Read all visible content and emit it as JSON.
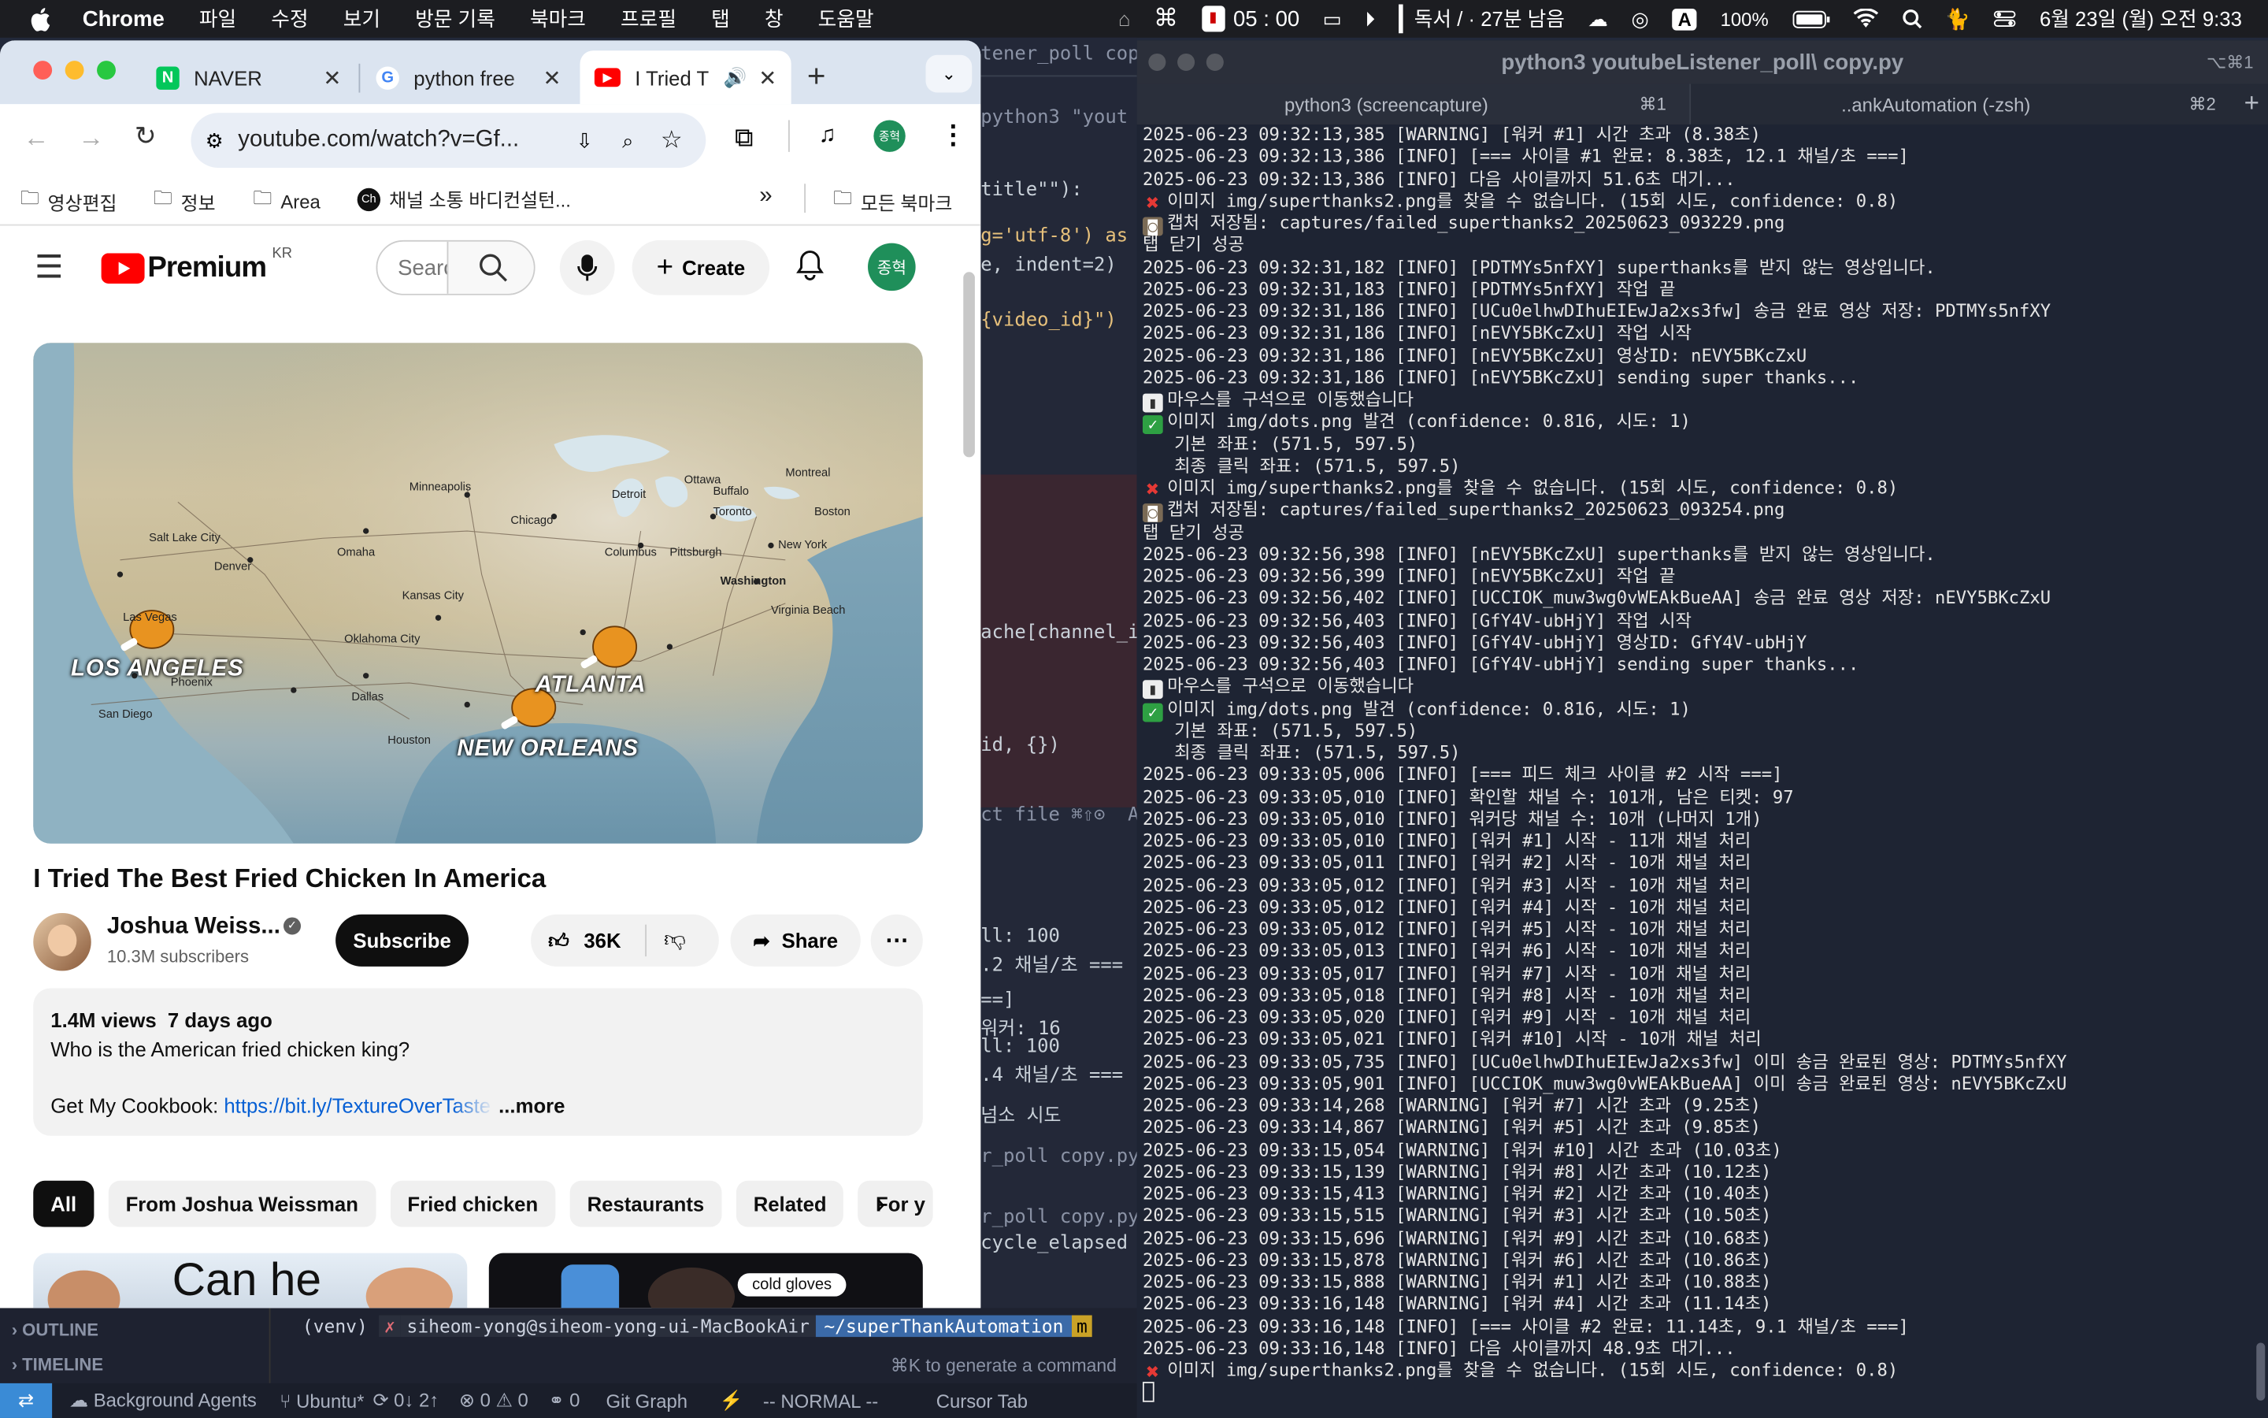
{
  "menubar": {
    "app": "Chrome",
    "items": [
      "파일",
      "수정",
      "보기",
      "방문 기록",
      "북마크",
      "프로필",
      "탭",
      "창",
      "도움말"
    ],
    "timer": "05 : 00",
    "reading": "독서 / · 27분 남음",
    "battery": "100%",
    "datetime": "6월 23일 (월) 오전 9:33",
    "input_source": "A"
  },
  "chrome": {
    "tabs": [
      {
        "title": "NAVER",
        "fav_color": "#03c75a",
        "fav_text": "N"
      },
      {
        "title": "python free",
        "fav_color": "#ffffff",
        "fav_text": "G"
      },
      {
        "title": "I Tried T",
        "fav_color": "#ff0000",
        "fav_text": "▶"
      }
    ],
    "url": "youtube.com/watch?v=Gf...",
    "profile": "종혁",
    "bookmarks": [
      "영상편집",
      "정보",
      "Area",
      "채널 소통 바디컨설턴...",
      "모든 북마크"
    ]
  },
  "youtube": {
    "logo_text": "Premium",
    "region": "KR",
    "search_placeholder": "Search",
    "create_label": "Create",
    "avatar": "종혁",
    "map_labels": {
      "la": "LOS ANGELES",
      "atlanta": "ATLANTA",
      "no": "NEW ORLEANS"
    },
    "map_cities": [
      "Ottawa",
      "Montreal",
      "Toronto",
      "Boston",
      "New York",
      "Washington",
      "Chicago",
      "Minneapolis",
      "Denver",
      "Kansas City",
      "Dallas",
      "Houston",
      "Phoenix",
      "San Diego",
      "Las Vegas",
      "Salt Lake City",
      "Pittsburgh",
      "Columbus",
      "Detroit",
      "Virginia Beach",
      "Buffalo",
      "Omaha",
      "Oklahoma City"
    ],
    "video_title": "I Tried The Best Fried Chicken In America",
    "channel": "Joshua Weiss...",
    "subscribers": "10.3M subscribers",
    "subscribe": "Subscribe",
    "likes": "36K",
    "share": "Share",
    "views_date": "1.4M views  7 days ago",
    "description_line1": "Who is the American fried chicken king?",
    "description_prefix": "Get My Cookbook:",
    "description_link": "https://bit.ly/TextureOverTaste",
    "more": "...more",
    "chips": [
      "All",
      "From Joshua Weissman",
      "Fried chicken",
      "Restaurants",
      "Related",
      "For y"
    ],
    "thumb1_text": "Can he",
    "thumb2_badge": "cold gloves"
  },
  "editor": {
    "lines": [
      {
        "t": "tener_poll copy.p",
        "c": "#8b93a6"
      },
      {
        "t": "python3 \"yout",
        "c": "#8b93a6"
      },
      {
        "t": "title\"\"):",
        "c": "#c9d1d9"
      },
      {
        "t": "g='utf-8') as",
        "c": "#e6c07b"
      },
      {
        "t": "e, indent=2)",
        "c": "#c9d1d9"
      },
      {
        "t": "{video_id}\")",
        "c": "#e6c07b"
      },
      {
        "t": "ache[channel_i",
        "c": "#c9d1d9"
      },
      {
        "t": "id, {})",
        "c": "#c9d1d9"
      },
      {
        "t": "ct file ⌘⇧⊙  Acce",
        "c": "#8b93a6"
      },
      {
        "t": "ll: 100",
        "c": "#c9d1d9"
      },
      {
        "t": ".2 채널/초 ===",
        "c": "#c9d1d9"
      },
      {
        "t": "==]",
        "c": "#c9d1d9"
      },
      {
        "t": "워커: 16",
        "c": "#c9d1d9"
      },
      {
        "t": "ll: 100",
        "c": "#c9d1d9"
      },
      {
        "t": ".4 채널/초 ===",
        "c": "#c9d1d9"
      },
      {
        "t": "넘소 시도",
        "c": "#c9d1d9"
      },
      {
        "t": "r_poll copy.py",
        "c": "#8b93a6"
      },
      {
        "t": "r_poll copy.py",
        "c": "#8b93a6"
      },
      {
        "t": "cycle_elapsed",
        "c": "#c9d1d9"
      }
    ],
    "panel_outline": "OUTLINE",
    "panel_timeline": "TIMELINE",
    "venv_prompt": "(venv)",
    "user_host": "siheom-yong@siheom-yong-ui-MacBookAir",
    "cwd": "~/superThankAutomation",
    "hint": "⌘K to generate a command"
  },
  "statusbar": {
    "items": [
      "Background Agents",
      "Ubuntu*",
      "0↓ 2↑",
      "⊗ 0 ⚠ 0",
      "0",
      "Git Graph",
      "-- NORMAL --",
      "Cursor Tab"
    ]
  },
  "terminal": {
    "title": "python3 youtubeListener_poll\\ copy.py",
    "title_shortcut": "⌥⌘1",
    "tab1": "python3 (screencapture)",
    "tab1_sc": "⌘1",
    "tab2": "..ankAutomation (-zsh)",
    "tab2_sc": "⌘2",
    "lines": [
      {
        "e": "",
        "t": "2025-06-23 09:32:13,385 [WARNING] [워커 #1] 시간 초과 (8.38초)"
      },
      {
        "e": "",
        "t": "2025-06-23 09:32:13,386 [INFO] [=== 사이클 #1 완료: 8.38초, 12.1 채널/초 ===]"
      },
      {
        "e": "",
        "t": "2025-06-23 09:32:13,386 [INFO] 다음 사이클까지 51.6초 대기..."
      },
      {
        "e": "x",
        "t": "이미지 img/superthanks2.png를 찾을 수 없습니다. (15회 시도, confidence: 0.8)"
      },
      {
        "e": "cam",
        "t": "캡처 저장됨: captures/failed_superthanks2_20250623_093229.png"
      },
      {
        "e": "",
        "t": "탭 닫기 성공"
      },
      {
        "e": "",
        "t": "2025-06-23 09:32:31,182 [INFO] [PDTMYs5nfXY] superthanks를 받지 않는 영상입니다."
      },
      {
        "e": "",
        "t": "2025-06-23 09:32:31,183 [INFO] [PDTMYs5nfXY] 작업 끝"
      },
      {
        "e": "",
        "t": "2025-06-23 09:32:31,186 [INFO] [UCu0elhwDIhuEIEwJa2xs3fw] 송금 완료 영상 저장: PDTMYs5nfXY"
      },
      {
        "e": "",
        "t": "2025-06-23 09:32:31,186 [INFO] [nEVY5BKcZxU] 작업 시작"
      },
      {
        "e": "",
        "t": "2025-06-23 09:32:31,186 [INFO] [nEVY5BKcZxU] 영상ID: nEVY5BKcZxU"
      },
      {
        "e": "",
        "t": "2025-06-23 09:32:31,186 [INFO] [nEVY5BKcZxU] sending super thanks..."
      },
      {
        "e": "mouse",
        "t": "마우스를 구석으로 이동했습니다"
      },
      {
        "e": "ok",
        "t": "이미지 img/dots.png 발견 (confidence: 0.816, 시도: 1)"
      },
      {
        "e": "",
        "t": "   기본 좌표: (571.5, 597.5)"
      },
      {
        "e": "",
        "t": "   최종 클릭 좌표: (571.5, 597.5)"
      },
      {
        "e": "x",
        "t": "이미지 img/superthanks2.png를 찾을 수 없습니다. (15회 시도, confidence: 0.8)"
      },
      {
        "e": "cam",
        "t": "캡처 저장됨: captures/failed_superthanks2_20250623_093254.png"
      },
      {
        "e": "",
        "t": "탭 닫기 성공"
      },
      {
        "e": "",
        "t": "2025-06-23 09:32:56,398 [INFO] [nEVY5BKcZxU] superthanks를 받지 않는 영상입니다."
      },
      {
        "e": "",
        "t": "2025-06-23 09:32:56,399 [INFO] [nEVY5BKcZxU] 작업 끝"
      },
      {
        "e": "",
        "t": "2025-06-23 09:32:56,402 [INFO] [UCCIOK_muw3wg0vWEAkBueAA] 송금 완료 영상 저장: nEVY5BKcZxU"
      },
      {
        "e": "",
        "t": "2025-06-23 09:32:56,403 [INFO] [GfY4V-ubHjY] 작업 시작"
      },
      {
        "e": "",
        "t": "2025-06-23 09:32:56,403 [INFO] [GfY4V-ubHjY] 영상ID: GfY4V-ubHjY"
      },
      {
        "e": "",
        "t": "2025-06-23 09:32:56,403 [INFO] [GfY4V-ubHjY] sending super thanks..."
      },
      {
        "e": "mouse",
        "t": "마우스를 구석으로 이동했습니다"
      },
      {
        "e": "ok",
        "t": "이미지 img/dots.png 발견 (confidence: 0.816, 시도: 1)"
      },
      {
        "e": "",
        "t": "   기본 좌표: (571.5, 597.5)"
      },
      {
        "e": "",
        "t": "   최종 클릭 좌표: (571.5, 597.5)"
      },
      {
        "e": "",
        "t": "2025-06-23 09:33:05,006 [INFO] [=== 피드 체크 사이클 #2 시작 ===]"
      },
      {
        "e": "",
        "t": "2025-06-23 09:33:05,010 [INFO] 확인할 채널 수: 101개, 남은 티켓: 97"
      },
      {
        "e": "",
        "t": "2025-06-23 09:33:05,010 [INFO] 워커당 채널 수: 10개 (나머지 1개)"
      },
      {
        "e": "",
        "t": "2025-06-23 09:33:05,010 [INFO] [워커 #1] 시작 - 11개 채널 처리"
      },
      {
        "e": "",
        "t": "2025-06-23 09:33:05,011 [INFO] [워커 #2] 시작 - 10개 채널 처리"
      },
      {
        "e": "",
        "t": "2025-06-23 09:33:05,012 [INFO] [워커 #3] 시작 - 10개 채널 처리"
      },
      {
        "e": "",
        "t": "2025-06-23 09:33:05,012 [INFO] [워커 #4] 시작 - 10개 채널 처리"
      },
      {
        "e": "",
        "t": "2025-06-23 09:33:05,012 [INFO] [워커 #5] 시작 - 10개 채널 처리"
      },
      {
        "e": "",
        "t": "2025-06-23 09:33:05,013 [INFO] [워커 #6] 시작 - 10개 채널 처리"
      },
      {
        "e": "",
        "t": "2025-06-23 09:33:05,017 [INFO] [워커 #7] 시작 - 10개 채널 처리"
      },
      {
        "e": "",
        "t": "2025-06-23 09:33:05,018 [INFO] [워커 #8] 시작 - 10개 채널 처리"
      },
      {
        "e": "",
        "t": "2025-06-23 09:33:05,020 [INFO] [워커 #9] 시작 - 10개 채널 처리"
      },
      {
        "e": "",
        "t": "2025-06-23 09:33:05,021 [INFO] [워커 #10] 시작 - 10개 채널 처리"
      },
      {
        "e": "",
        "t": "2025-06-23 09:33:05,735 [INFO] [UCu0elhwDIhuEIEwJa2xs3fw] 이미 송금 완료된 영상: PDTMYs5nfXY"
      },
      {
        "e": "",
        "t": "2025-06-23 09:33:05,901 [INFO] [UCCIOK_muw3wg0vWEAkBueAA] 이미 송금 완료된 영상: nEVY5BKcZxU"
      },
      {
        "e": "",
        "t": "2025-06-23 09:33:14,268 [WARNING] [워커 #7] 시간 초과 (9.25초)"
      },
      {
        "e": "",
        "t": "2025-06-23 09:33:14,867 [WARNING] [워커 #5] 시간 초과 (9.85초)"
      },
      {
        "e": "",
        "t": "2025-06-23 09:33:15,054 [WARNING] [워커 #10] 시간 초과 (10.03초)"
      },
      {
        "e": "",
        "t": "2025-06-23 09:33:15,139 [WARNING] [워커 #8] 시간 초과 (10.12초)"
      },
      {
        "e": "",
        "t": "2025-06-23 09:33:15,413 [WARNING] [워커 #2] 시간 초과 (10.40초)"
      },
      {
        "e": "",
        "t": "2025-06-23 09:33:15,515 [WARNING] [워커 #3] 시간 초과 (10.50초)"
      },
      {
        "e": "",
        "t": "2025-06-23 09:33:15,696 [WARNING] [워커 #9] 시간 초과 (10.68초)"
      },
      {
        "e": "",
        "t": "2025-06-23 09:33:15,878 [WARNING] [워커 #6] 시간 초과 (10.86초)"
      },
      {
        "e": "",
        "t": "2025-06-23 09:33:15,888 [WARNING] [워커 #1] 시간 초과 (10.88초)"
      },
      {
        "e": "",
        "t": "2025-06-23 09:33:16,148 [WARNING] [워커 #4] 시간 초과 (11.14초)"
      },
      {
        "e": "",
        "t": "2025-06-23 09:33:16,148 [INFO] [=== 사이클 #2 완료: 11.14초, 9.1 채널/초 ===]"
      },
      {
        "e": "",
        "t": "2025-06-23 09:33:16,148 [INFO] 다음 사이클까지 48.9초 대기..."
      },
      {
        "e": "x",
        "t": "이미지 img/superthanks2.png를 찾을 수 없습니다. (15회 시도, confidence: 0.8)"
      }
    ]
  }
}
